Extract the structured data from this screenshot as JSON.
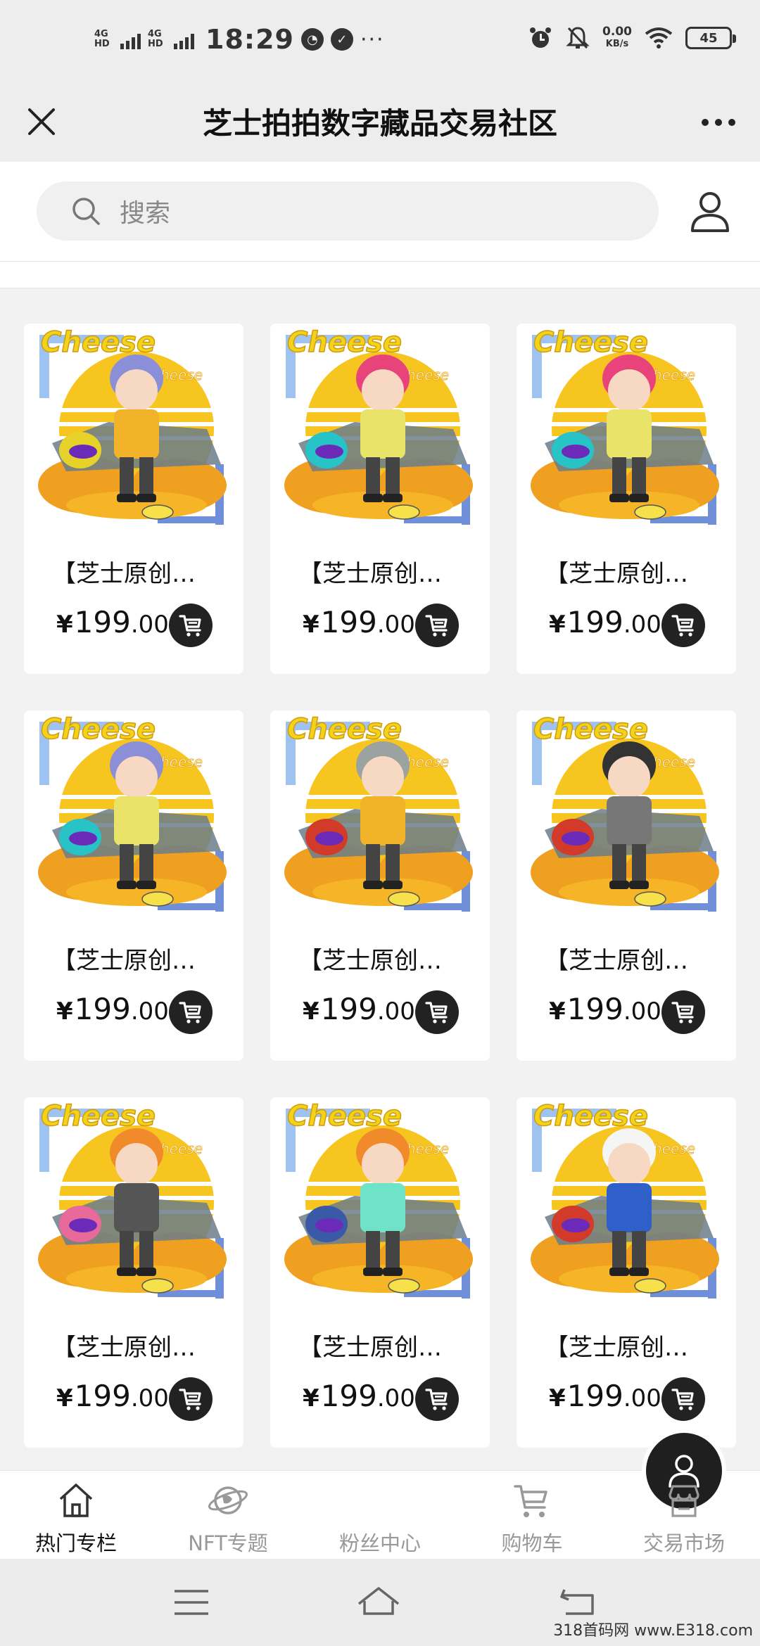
{
  "status_bar": {
    "network1": "4G HD",
    "network2": "4G HD",
    "time": "18:29",
    "more": "···",
    "speed_value": "0.00",
    "speed_unit": "KB/s",
    "battery": "45"
  },
  "header": {
    "title": "芝士拍拍数字藏品交易社区"
  },
  "search": {
    "placeholder": "搜索"
  },
  "products": [
    {
      "title": "【芝士原创…",
      "currency": "¥",
      "price_int": "199",
      "price_dec": ".00",
      "hair": "#8a8fd8",
      "outfit": "#f2b32a",
      "helmet": "#e7d22a"
    },
    {
      "title": "【芝士原创…",
      "currency": "¥",
      "price_int": "199",
      "price_dec": ".00",
      "hair": "#e8437a",
      "outfit": "#e9e36a",
      "helmet": "#27c3c7"
    },
    {
      "title": "【芝士原创…",
      "currency": "¥",
      "price_int": "199",
      "price_dec": ".00",
      "hair": "#e8437a",
      "outfit": "#e9e36a",
      "helmet": "#27c3c7"
    },
    {
      "title": "【芝士原创…",
      "currency": "¥",
      "price_int": "199",
      "price_dec": ".00",
      "hair": "#8a8fd8",
      "outfit": "#e9e36a",
      "helmet": "#27c3c7"
    },
    {
      "title": "【芝士原创…",
      "currency": "¥",
      "price_int": "199",
      "price_dec": ".00",
      "hair": "#9aa3a0",
      "outfit": "#f2b32a",
      "helmet": "#d23a2a"
    },
    {
      "title": "【芝士原创…",
      "currency": "¥",
      "price_int": "199",
      "price_dec": ".00",
      "hair": "#333333",
      "outfit": "#777777",
      "helmet": "#d23a2a"
    },
    {
      "title": "【芝士原创…",
      "currency": "¥",
      "price_int": "199",
      "price_dec": ".00",
      "hair": "#f08a2a",
      "outfit": "#555555",
      "helmet": "#e86a9a"
    },
    {
      "title": "【芝士原创…",
      "currency": "¥",
      "price_int": "199",
      "price_dec": ".00",
      "hair": "#f08a2a",
      "outfit": "#6fe3c7",
      "helmet": "#3a5aa8"
    },
    {
      "title": "【芝士原创…",
      "currency": "¥",
      "price_int": "199",
      "price_dec": ".00",
      "hair": "#f5f5f5",
      "outfit": "#2f5fc8",
      "helmet": "#d23a2a"
    }
  ],
  "tabs": [
    {
      "label": "热门专栏",
      "icon": "home-icon",
      "active": true
    },
    {
      "label": "NFT专题",
      "icon": "globe-icon",
      "active": false
    },
    {
      "label": "粉丝中心",
      "icon": "user-icon",
      "active": false
    },
    {
      "label": "购物车",
      "icon": "cart-icon",
      "active": false
    },
    {
      "label": "交易市场",
      "icon": "market-icon",
      "active": false
    }
  ],
  "watermark": "318首码网 www.E318.com"
}
